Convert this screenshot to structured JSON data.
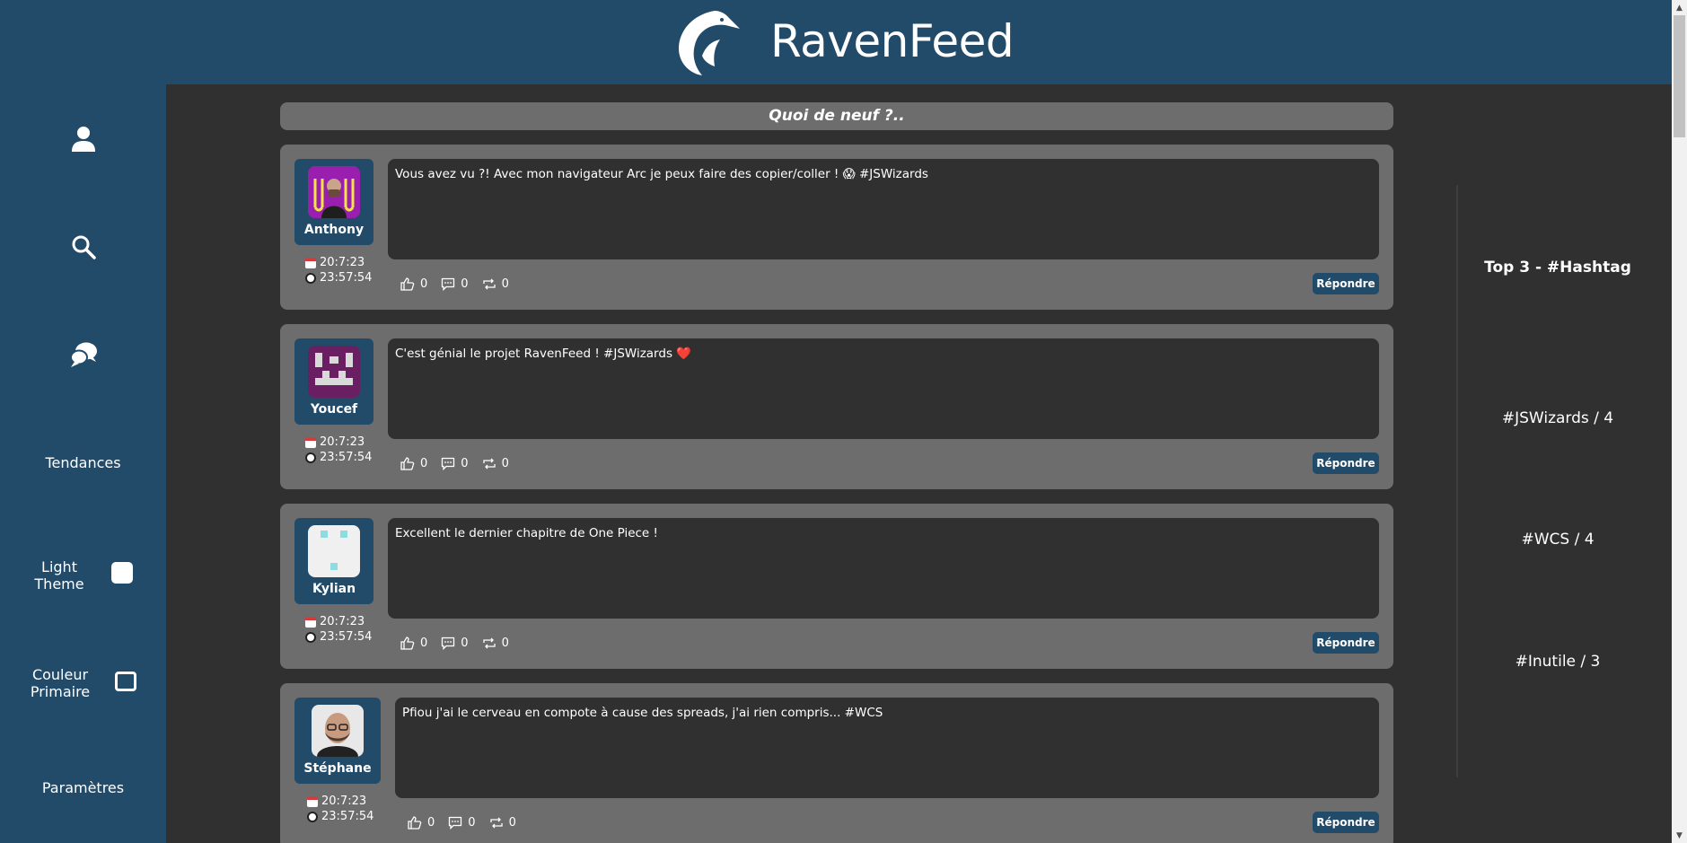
{
  "header": {
    "title": "RavenFeed"
  },
  "sidebar": {
    "profile_icon": "user-icon",
    "search_icon": "search-icon",
    "messages_icon": "chat-bubbles-icon",
    "trends_label": "Tendances",
    "light_theme_label": "Light\nTheme",
    "primary_color_label": "Couleur\nPrimaire",
    "settings_label": "Paramètres"
  },
  "compose": {
    "placeholder": "Quoi de neuf ?.."
  },
  "posts": [
    {
      "author": "Anthony",
      "date": "20:7:23",
      "time": "23:57:54",
      "text": "Vous avez vu ?! Avec mon navigateur Arc je peux faire des copier/coller ! 😱 #JSWizards",
      "likes": "0",
      "comments": "0",
      "reposts": "0",
      "reply_label": "Répondre"
    },
    {
      "author": "Youcef",
      "date": "20:7:23",
      "time": "23:57:54",
      "text": "C'est génial le projet RavenFeed ! #JSWizards ❤️",
      "likes": "0",
      "comments": "0",
      "reposts": "0",
      "reply_label": "Répondre"
    },
    {
      "author": "Kylian",
      "date": "20:7:23",
      "time": "23:57:54",
      "text": "Excellent le dernier chapitre de One Piece !",
      "likes": "0",
      "comments": "0",
      "reposts": "0",
      "reply_label": "Répondre"
    },
    {
      "author": "Stéphane",
      "date": "20:7:23",
      "time": "23:57:54",
      "text": "Pfiou j'ai le cerveau en compote à cause des spreads, j'ai rien compris... #WCS",
      "likes": "0",
      "comments": "0",
      "reposts": "0",
      "reply_label": "Répondre"
    }
  ],
  "trends": {
    "title": "Top 3 - #Hashtag",
    "items": [
      "#JSWizards / 4",
      "#WCS / 4",
      "#Inutile / 3"
    ]
  },
  "colors": {
    "primary": "#224a69",
    "background": "#303030",
    "card": "#6d6d6d"
  }
}
